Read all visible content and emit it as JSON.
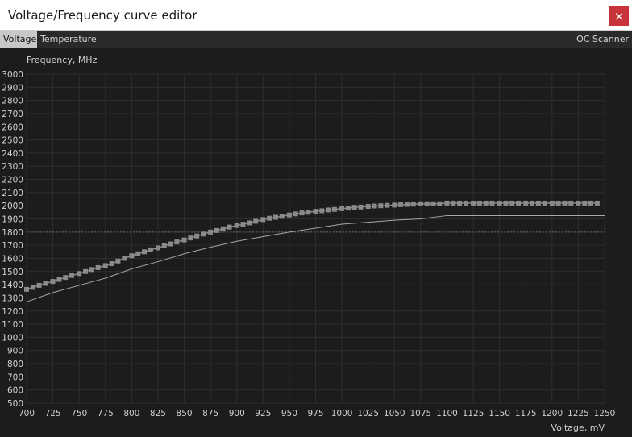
{
  "window": {
    "title": "Voltage/Frequency curve editor",
    "close_label": "×"
  },
  "tabs": [
    {
      "label": "Voltage",
      "active": true
    },
    {
      "label": "Temperature",
      "active": false
    }
  ],
  "oc_scanner_label": "OC Scanner",
  "colors": {
    "background": "#1c1c1e",
    "grid": "#2e2e30",
    "curve": "#8a8a8a",
    "reference": "#a6a6a6",
    "dashed": "#6a6a6a"
  },
  "chart_data": {
    "type": "line",
    "ylabel": "Frequency, MHz",
    "xlabel": "Voltage, mV",
    "xlim": [
      700,
      1250
    ],
    "ylim": [
      500,
      3000
    ],
    "xticks": [
      700,
      725,
      750,
      775,
      800,
      825,
      850,
      875,
      900,
      925,
      950,
      975,
      1000,
      1025,
      1050,
      1075,
      1100,
      1125,
      1150,
      1175,
      1200,
      1225,
      1250
    ],
    "yticks": [
      500,
      600,
      700,
      800,
      900,
      1000,
      1100,
      1200,
      1300,
      1400,
      1500,
      1600,
      1700,
      1800,
      1900,
      2000,
      2100,
      2200,
      2300,
      2400,
      2500,
      2600,
      2700,
      2800,
      2900,
      3000
    ],
    "grid": true,
    "dashed_reference_mhz": 1800,
    "series": [
      {
        "style": "editable-points",
        "x": [
          700,
          706,
          712,
          718,
          725,
          731,
          737,
          743,
          750,
          756,
          762,
          768,
          775,
          781,
          787,
          793,
          800,
          806,
          812,
          818,
          825,
          831,
          837,
          843,
          850,
          856,
          862,
          868,
          875,
          881,
          887,
          893,
          900,
          906,
          912,
          918,
          925,
          931,
          937,
          943,
          950,
          956,
          962,
          968,
          975,
          981,
          987,
          993,
          1000,
          1006,
          1012,
          1018,
          1025,
          1031,
          1037,
          1043,
          1050,
          1056,
          1062,
          1068,
          1075,
          1081,
          1087,
          1093,
          1100,
          1106,
          1112,
          1118,
          1125,
          1131,
          1137,
          1143,
          1150,
          1156,
          1162,
          1168,
          1175,
          1181,
          1187,
          1193,
          1200,
          1206,
          1212,
          1218,
          1225,
          1231,
          1237,
          1243
        ],
        "y": [
          1365,
          1380,
          1395,
          1410,
          1425,
          1440,
          1455,
          1470,
          1485,
          1500,
          1515,
          1530,
          1545,
          1560,
          1580,
          1600,
          1620,
          1635,
          1650,
          1665,
          1680,
          1695,
          1710,
          1725,
          1740,
          1755,
          1770,
          1785,
          1800,
          1812,
          1825,
          1838,
          1850,
          1860,
          1870,
          1882,
          1895,
          1905,
          1912,
          1920,
          1930,
          1938,
          1945,
          1950,
          1958,
          1962,
          1968,
          1972,
          1978,
          1982,
          1988,
          1990,
          1995,
          1998,
          2000,
          2003,
          2005,
          2008,
          2010,
          2012,
          2015,
          2015,
          2015,
          2015,
          2020,
          2020,
          2020,
          2020,
          2020,
          2020,
          2020,
          2020,
          2020,
          2020,
          2020,
          2020,
          2020,
          2020,
          2020,
          2020,
          2020,
          2020,
          2020,
          2020,
          2020,
          2020,
          2020,
          2020
        ]
      },
      {
        "style": "thin-line",
        "x": [
          700,
          725,
          750,
          775,
          800,
          825,
          850,
          875,
          900,
          925,
          950,
          975,
          1000,
          1025,
          1050,
          1075,
          1100,
          1125,
          1150,
          1175,
          1200,
          1225,
          1250
        ],
        "y": [
          1270,
          1340,
          1395,
          1450,
          1520,
          1575,
          1635,
          1685,
          1730,
          1765,
          1800,
          1830,
          1860,
          1875,
          1890,
          1900,
          1925,
          1925,
          1925,
          1925,
          1925,
          1925,
          1925
        ]
      }
    ]
  }
}
